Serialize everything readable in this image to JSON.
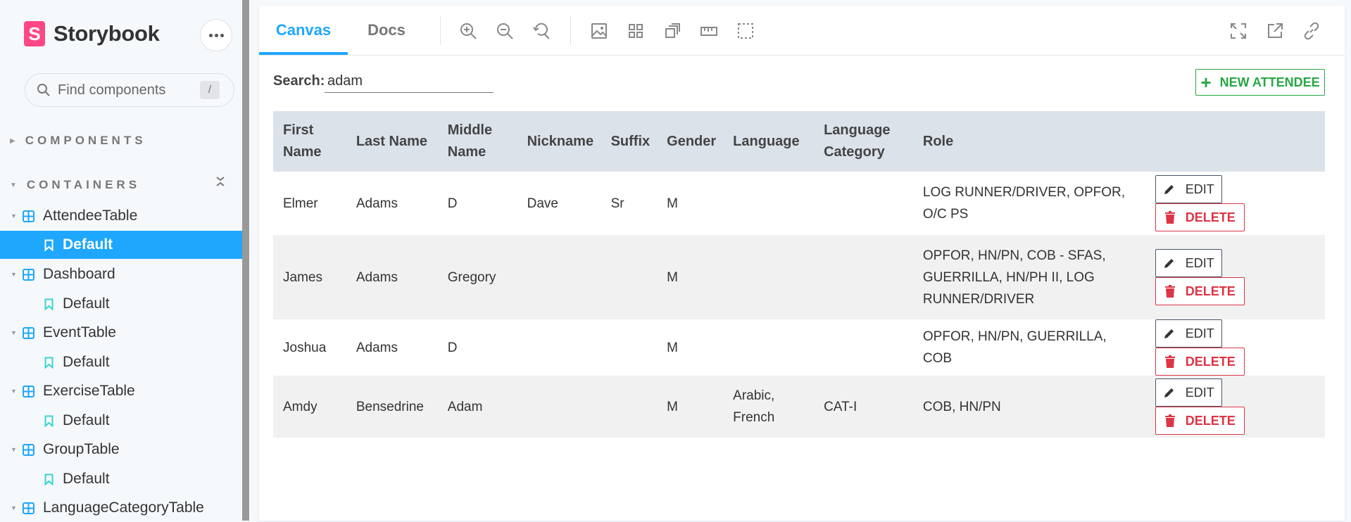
{
  "sidebar": {
    "brand": "Storybook",
    "brand_logo_letter": "S",
    "search_placeholder": "Find components",
    "search_shortcut": "/",
    "sections": [
      {
        "label": "COMPONENTS"
      },
      {
        "label": "CONTAINERS"
      }
    ],
    "tree": [
      {
        "component": "AttendeeTable",
        "story": "Default",
        "selected": true
      },
      {
        "component": "Dashboard",
        "story": "Default",
        "selected": false
      },
      {
        "component": "EventTable",
        "story": "Default",
        "selected": false
      },
      {
        "component": "ExerciseTable",
        "story": "Default",
        "selected": false
      },
      {
        "component": "GroupTable",
        "story": "Default",
        "selected": false
      },
      {
        "component": "LanguageCategoryTable"
      }
    ]
  },
  "toolbar": {
    "tabs": [
      "Canvas",
      "Docs"
    ],
    "active_tab": "Canvas"
  },
  "content": {
    "search_label": "Search:",
    "search_value": "adam",
    "new_button": "NEW ATTENDEE",
    "columns": [
      "First Name",
      "Last Name",
      "Middle Name",
      "Nickname",
      "Suffix",
      "Gender",
      "Language",
      "Language Category",
      "Role",
      ""
    ],
    "rows": [
      [
        "Elmer",
        "Adams",
        "D",
        "Dave",
        "Sr",
        "M",
        "",
        "",
        "LOG RUNNER/DRIVER, OPFOR, O/C PS"
      ],
      [
        "James",
        "Adams",
        "Gregory",
        "",
        "",
        "M",
        "",
        "",
        "OPFOR, HN/PN, COB - SFAS, GUERRILLA, HN/PH II, LOG RUNNER/DRIVER"
      ],
      [
        "Joshua",
        "Adams",
        "D",
        "",
        "",
        "M",
        "",
        "",
        "OPFOR, HN/PN, GUERRILLA, COB"
      ],
      [
        "Amdy",
        "Bensedrine",
        "Adam",
        "",
        "",
        "M",
        "Arabic, French",
        "CAT-I",
        "COB, HN/PN"
      ]
    ],
    "edit_label": "EDIT",
    "delete_label": "DELETE"
  },
  "colors": {
    "accent": "#1ea7fd",
    "brand": "#ff4785",
    "success": "#28a745",
    "danger": "#dc3545",
    "header_bg": "#dce2ea"
  }
}
